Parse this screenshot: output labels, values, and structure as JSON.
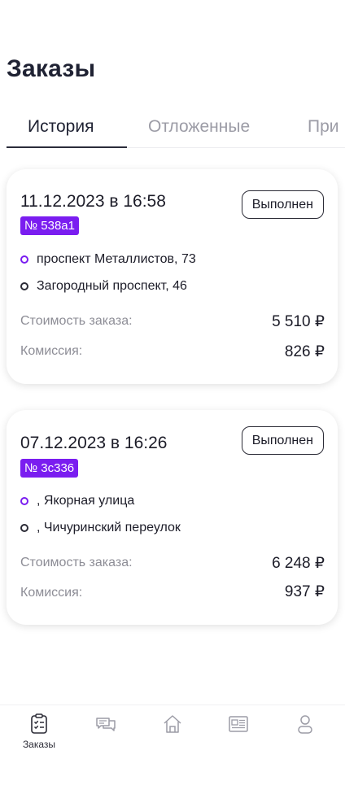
{
  "page": {
    "title": "Заказы"
  },
  "tabs": [
    {
      "label": "История",
      "active": true
    },
    {
      "label": "Отложенные",
      "active": false
    },
    {
      "label": "При",
      "active": false
    }
  ],
  "orders": [
    {
      "datetime": "11.12.2023 в 16:58",
      "status": "Выполнен",
      "number": "№ 538a1",
      "from": "проспект Металлистов, 73",
      "to": "Загородный проспект, 46",
      "cost_label": "Стоимость заказа:",
      "cost": "5 510 ₽",
      "commission_label": "Комиссия:",
      "commission": "826 ₽"
    },
    {
      "datetime": "07.12.2023 в 16:26",
      "status": "Выполнен",
      "number": "№ 3c336",
      "from": ", Якорная улица",
      "to": ", Чичуринский переулок",
      "cost_label": "Стоимость заказа:",
      "cost": "6 248 ₽",
      "commission_label": "Комиссия:",
      "commission": "937 ₽"
    }
  ],
  "bottom_nav": [
    {
      "icon": "orders-list-icon",
      "label": "Заказы",
      "active": true
    },
    {
      "icon": "chat-icon",
      "label": "",
      "active": false
    },
    {
      "icon": "home-icon",
      "label": "",
      "active": false
    },
    {
      "icon": "news-icon",
      "label": "",
      "active": false
    },
    {
      "icon": "profile-icon",
      "label": "",
      "active": false
    }
  ],
  "colors": {
    "accent": "#7a1df0",
    "text": "#1c1c28",
    "muted": "#8d8d96",
    "inactive_icon": "#9c9ca6"
  }
}
